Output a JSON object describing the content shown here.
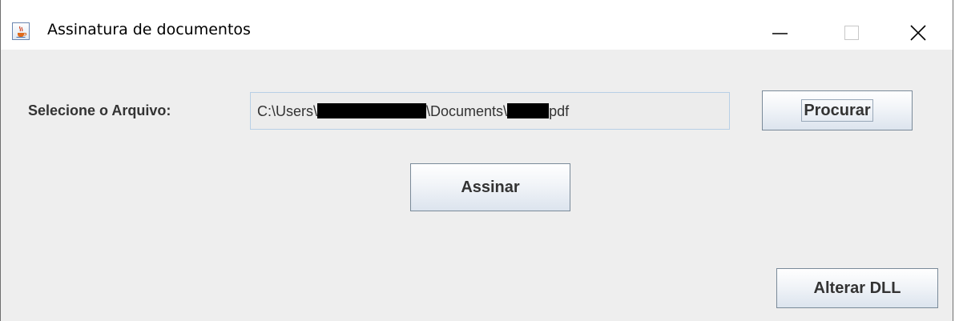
{
  "window": {
    "title": "Assinatura de documentos",
    "icon": "java-cup-icon",
    "controls": {
      "minimize": "minimize-icon",
      "maximize": "maximize-icon",
      "close": "close-icon"
    }
  },
  "form": {
    "file_label": "Selecione o Arquivo:",
    "file_path": {
      "prefix": "C:\\Users\\",
      "middle": "\\Documents\\",
      "suffix": "pdf"
    }
  },
  "buttons": {
    "browse_label": "Procurar",
    "sign_label": "Assinar",
    "change_dll_label": "Alterar DLL"
  },
  "colors": {
    "content_background": "#eeeeee",
    "field_border": "#b8cfe5",
    "text": "#333333"
  }
}
